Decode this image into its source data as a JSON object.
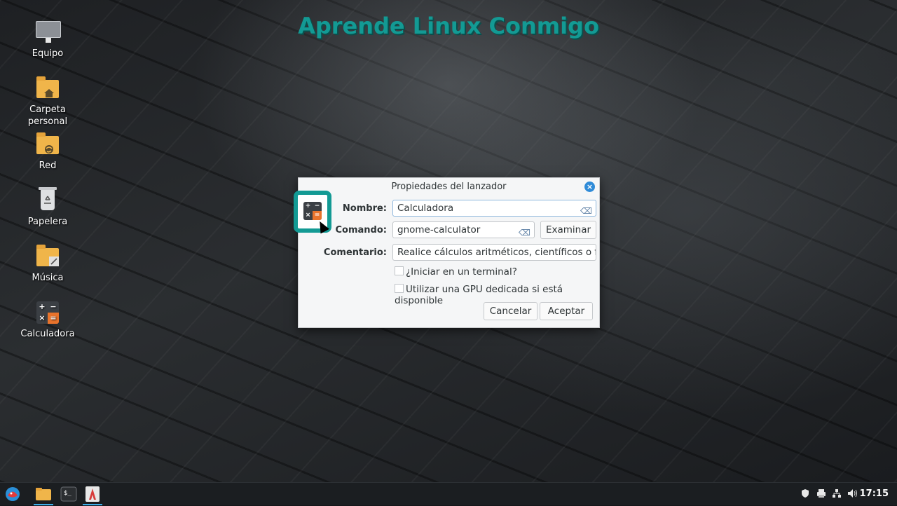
{
  "banner": {
    "text": "Aprende Linux Conmigo",
    "color": "#139a94"
  },
  "desktop": {
    "icons": [
      {
        "label": "Equipo",
        "icon": "computer-icon"
      },
      {
        "label": "Carpeta personal",
        "icon": "home-folder-icon"
      },
      {
        "label": "Red",
        "icon": "network-folder-icon"
      },
      {
        "label": "Papelera",
        "icon": "trash-icon"
      },
      {
        "label": "Música",
        "icon": "music-folder-icon"
      },
      {
        "label": "Calculadora",
        "icon": "calculator-icon"
      }
    ]
  },
  "dialog": {
    "title": "Propiedades del lanzador",
    "name_label": "Nombre:",
    "name_value": "Calculadora",
    "command_label": "Comando:",
    "command_value": "gnome-calculator",
    "browse_label": "Examinar",
    "comment_label": "Comentario:",
    "comment_value": "Realice cálculos aritméticos, científicos o fin",
    "terminal_label": "¿Iniciar en un terminal?",
    "gpu_label": "Utilizar una GPU dedicada si está disponible",
    "cancel_label": "Cancelar",
    "accept_label": "Aceptar",
    "accent": "#139a94"
  },
  "taskbar": {
    "clock": "17:15",
    "items": [
      "start-menu-icon",
      "file-manager-icon",
      "terminal-icon",
      "launcher-app-icon"
    ],
    "tray": [
      "shield-icon",
      "printer-icon",
      "network-icon",
      "volume-icon"
    ]
  }
}
